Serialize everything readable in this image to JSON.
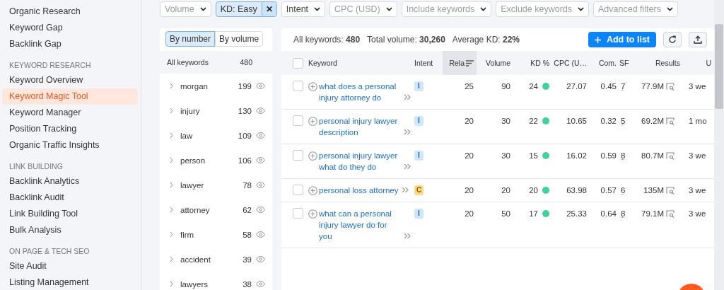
{
  "sidebar": {
    "sections": [
      {
        "items": [
          {
            "label": "Organic Research",
            "selected": false
          },
          {
            "label": "Keyword Gap",
            "selected": false
          },
          {
            "label": "Backlink Gap",
            "selected": false
          }
        ]
      },
      {
        "heading": "KEYWORD RESEARCH",
        "items": [
          {
            "label": "Keyword Overview",
            "selected": false
          },
          {
            "label": "Keyword Magic Tool",
            "selected": true
          },
          {
            "label": "Keyword Manager",
            "selected": false
          },
          {
            "label": "Position Tracking",
            "selected": false
          },
          {
            "label": "Organic Traffic Insights",
            "selected": false
          }
        ]
      },
      {
        "heading": "LINK BUILDING",
        "items": [
          {
            "label": "Backlink Analytics",
            "selected": false
          },
          {
            "label": "Backlink Audit",
            "selected": false
          },
          {
            "label": "Link Building Tool",
            "selected": false
          },
          {
            "label": "Bulk Analysis",
            "selected": false
          }
        ]
      },
      {
        "heading": "ON PAGE & TECH SEO",
        "items": [
          {
            "label": "Site Audit",
            "selected": false
          },
          {
            "label": "Listing Management",
            "selected": false
          }
        ]
      }
    ]
  },
  "filters": [
    {
      "kind": "dropdown",
      "label": "Volume",
      "disabled": true
    },
    {
      "kind": "chip",
      "label": "KD: Easy",
      "close": "✕"
    },
    {
      "kind": "dropdown",
      "label": "Intent",
      "disabled": false
    },
    {
      "kind": "dropdown",
      "label": "CPC (USD)",
      "disabled": true
    },
    {
      "kind": "dropdown",
      "label": "Include keywords",
      "disabled": true
    },
    {
      "kind": "dropdown",
      "label": "Exclude keywords",
      "disabled": true
    },
    {
      "kind": "dropdown",
      "label": "Advanced filters",
      "disabled": true
    }
  ],
  "groups_panel": {
    "tabs": [
      {
        "label": "By number",
        "selected": true
      },
      {
        "label": "By volume",
        "selected": false
      }
    ],
    "header": {
      "label": "All keywords",
      "count": "480"
    },
    "groups": [
      {
        "label": "morgan",
        "count": "199"
      },
      {
        "label": "injury",
        "count": "130"
      },
      {
        "label": "law",
        "count": "109"
      },
      {
        "label": "person",
        "count": "106"
      },
      {
        "label": "lawyer",
        "count": "78"
      },
      {
        "label": "attorney",
        "count": "62"
      },
      {
        "label": "firm",
        "count": "58"
      },
      {
        "label": "accident",
        "count": "39"
      },
      {
        "label": "lawyers",
        "count": "38"
      }
    ]
  },
  "table": {
    "summary": [
      "All keywords: **480**",
      "Total volume: **30,260**",
      "Average KD: **22%**"
    ],
    "add_button": "Add to list",
    "header_checked": false,
    "columns": [
      {
        "label": "Keyword",
        "sorted": false
      },
      {
        "label": "Intent",
        "sorted": false
      },
      {
        "label": "Rela",
        "sorted": true
      },
      {
        "label": "Volume",
        "sorted": false
      },
      {
        "label": "KD %",
        "sorted": false
      },
      {
        "label": "CPC (U…",
        "sorted": false
      },
      {
        "label": "Com.",
        "sorted": false
      },
      {
        "label": "SF",
        "sorted": false
      },
      {
        "label": "Results",
        "sorted": false
      },
      {
        "label": "U",
        "sorted": false
      }
    ],
    "rows": [
      {
        "checked": false,
        "keyword": "what does a personal injury attorney do",
        "intent": {
          "label": "I",
          "kind": "informational"
        },
        "relevance": "25",
        "volume": "90",
        "kd": "24",
        "cpc": "27.07",
        "com": "0.45",
        "sf": "7",
        "results": "77.9M",
        "updated": "3 we"
      },
      {
        "checked": false,
        "keyword": "personal injury lawyer description",
        "intent": {
          "label": "I",
          "kind": "informational"
        },
        "relevance": "20",
        "volume": "30",
        "kd": "22",
        "cpc": "10.65",
        "com": "0.32",
        "sf": "5",
        "results": "69.2M",
        "updated": "1 mo"
      },
      {
        "checked": false,
        "keyword": "personal injury lawyer what do they do",
        "intent": {
          "label": "I",
          "kind": "informational"
        },
        "relevance": "20",
        "volume": "30",
        "kd": "15",
        "cpc": "16.02",
        "com": "0.59",
        "sf": "8",
        "results": "80.7M",
        "updated": "3 we"
      },
      {
        "checked": false,
        "keyword": "personal loss attorney",
        "intent": {
          "label": "C",
          "kind": "commercial"
        },
        "relevance": "20",
        "volume": "20",
        "kd": "20",
        "cpc": "63.98",
        "com": "0.57",
        "sf": "6",
        "results": "135M",
        "updated": "3 we"
      },
      {
        "checked": false,
        "keyword": "what can a personal injury lawyer do for you",
        "intent": {
          "label": "I",
          "kind": "informational"
        },
        "relevance": "20",
        "volume": "50",
        "kd": "17",
        "cpc": "25.33",
        "com": "0.64",
        "sf": "8",
        "results": "79.1M",
        "updated": "3 we"
      }
    ]
  }
}
